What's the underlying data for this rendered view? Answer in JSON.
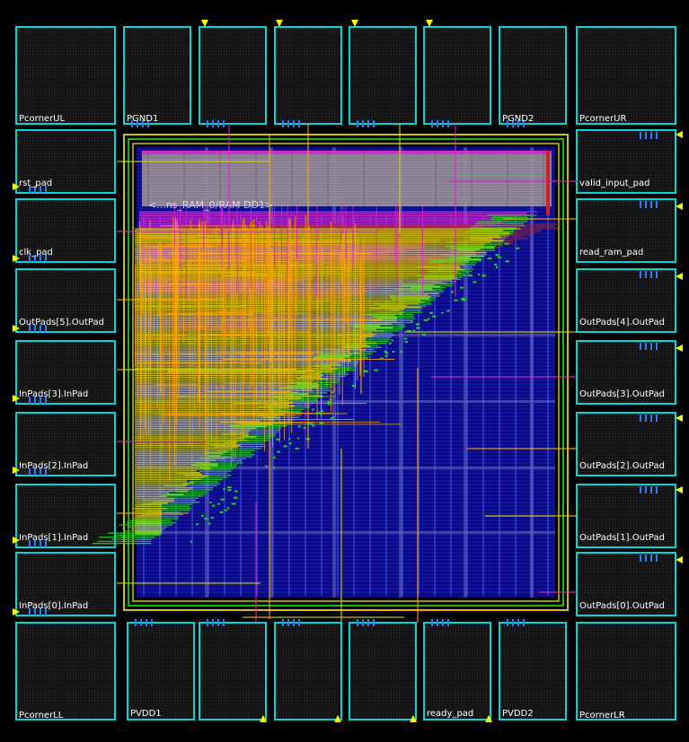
{
  "diagram": {
    "macro_label": "<...ns_RAM_0/RAM DD1>",
    "corners": {
      "ul": "PcornerUL",
      "ur": "PcornerUR",
      "ll": "PcornerLL",
      "lr": "PcornerLR"
    },
    "top_pads": [
      "",
      "PGND1",
      "",
      "",
      "",
      "",
      "PGND2"
    ],
    "left_pads": [
      "rst_pad",
      "clk_pad",
      "OutPads[5].OutPad",
      "InPads[3].InPad",
      "InPads[2].InPad",
      "InPads[1].InPad",
      "InPads[0].InPad"
    ],
    "right_pads": [
      "valid_input_pad",
      "read_ram_pad",
      "OutPads[4].OutPad",
      "OutPads[3].OutPad",
      "OutPads[2].OutPad",
      "OutPads[1].OutPad",
      "OutPads[0].OutPad"
    ],
    "bottom_pads": [
      "",
      "PVDD1",
      "",
      "",
      "",
      "ready_pad",
      "PVDD2"
    ],
    "colors": {
      "background": "#000000",
      "pad_outline": "#00d8d8",
      "pad_fill": "#151515",
      "core_fill": "#0a0a8a",
      "core_grid": "#3040c0",
      "ram": "#a0a0a0",
      "metal_yellow": "#d4d400",
      "metal_orange": "#ffa500",
      "metal_magenta": "#e020d0",
      "metal_green": "#20d020",
      "metal_red": "#c02020",
      "pin_yellow": "#ffff00"
    }
  }
}
